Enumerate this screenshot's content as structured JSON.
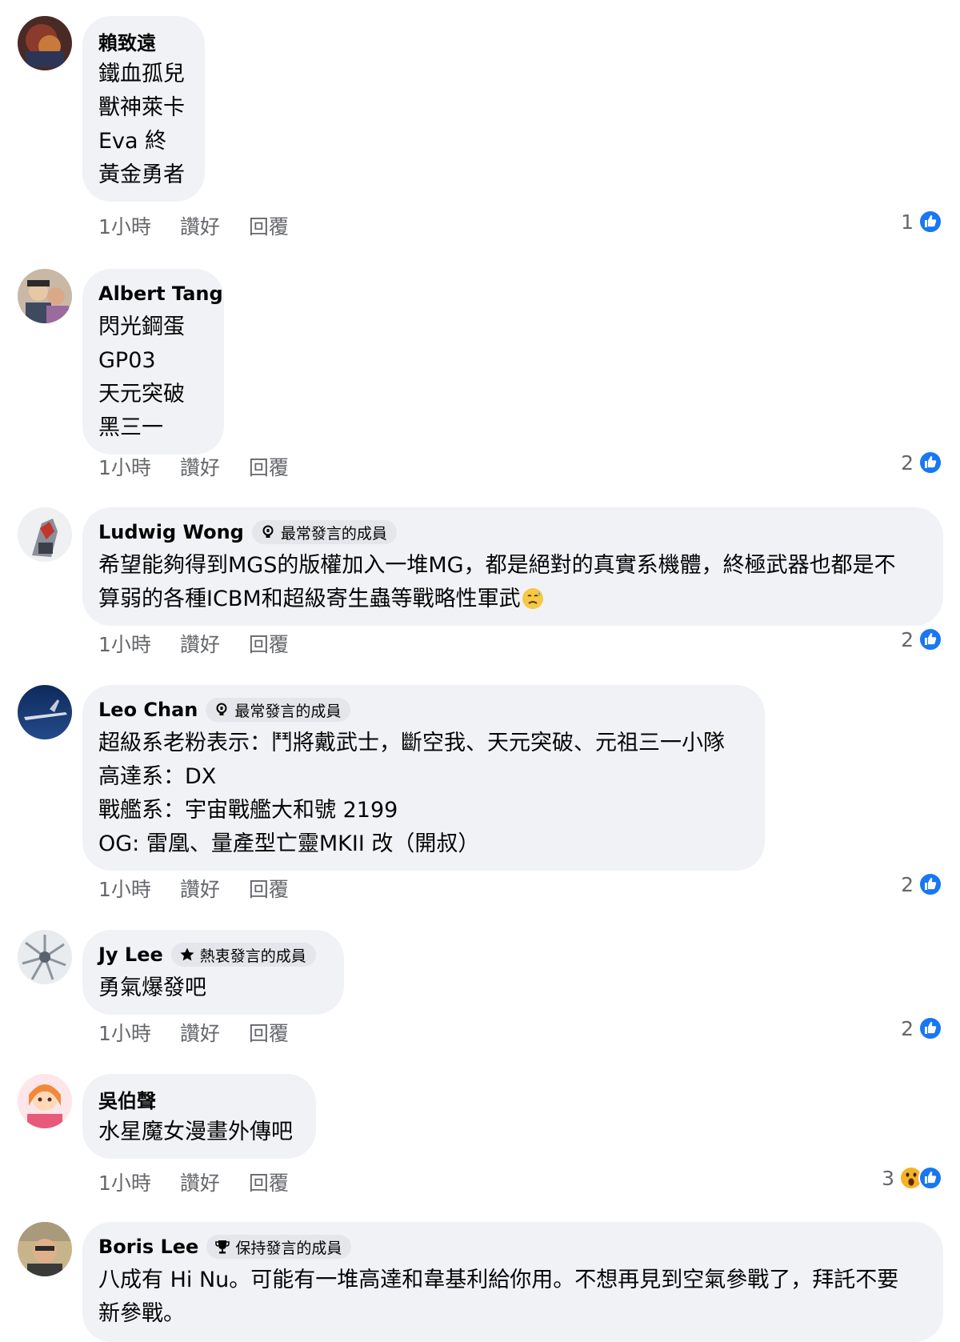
{
  "comments": [
    {
      "author": "賴致遠",
      "badge": "",
      "lines": [
        "鐵血孤兒",
        "獸神萊卡",
        "Eva 終",
        "黃金勇者"
      ],
      "time": "1小時",
      "like_label": "讚好",
      "reply_label": "回覆",
      "reaction_count": "1",
      "reactions": [
        "like"
      ]
    },
    {
      "author": "Albert Tang",
      "badge": "",
      "lines": [
        "閃光鋼蛋",
        "GP03",
        "天元突破",
        "黑三一"
      ],
      "time": "1小時",
      "like_label": "讚好",
      "reply_label": "回覆",
      "reaction_count": "2",
      "reactions": [
        "like"
      ]
    },
    {
      "author": "Ludwig Wong",
      "badge": "最常發言的成員",
      "badge_icon": "lightbulb-icon",
      "lines": [
        "希望能夠得到MGS的版權加入一堆MG，都是絕對的真實系機體，終極武器也都是不",
        "算弱的各種ICBM和超級寄生蟲等戰略性軍武"
      ],
      "inline_emoji": "sad-sweat-emoji",
      "time": "1小時",
      "like_label": "讚好",
      "reply_label": "回覆",
      "reaction_count": "2",
      "reactions": [
        "like"
      ]
    },
    {
      "author": "Leo Chan",
      "badge": "最常發言的成員",
      "badge_icon": "lightbulb-icon",
      "lines": [
        "超級系老粉表示：鬥將戴武士，斷空我、天元突破、元祖三一小隊",
        "高達系：DX",
        "戰艦系：宇宙戰艦大和號 2199",
        "OG: 雷凰、量產型亡靈MKII 改（開叔）"
      ],
      "time": "1小時",
      "like_label": "讚好",
      "reply_label": "回覆",
      "reaction_count": "2",
      "reactions": [
        "like"
      ]
    },
    {
      "author": "Jy Lee",
      "badge": "熱衷發言的成員",
      "badge_icon": "star-icon",
      "lines": [
        "勇氣爆發吧"
      ],
      "time": "1小時",
      "like_label": "讚好",
      "reply_label": "回覆",
      "reaction_count": "2",
      "reactions": [
        "like"
      ]
    },
    {
      "author": "吳伯聲",
      "badge": "",
      "lines": [
        "水星魔女漫畫外傳吧"
      ],
      "time": "1小時",
      "like_label": "讚好",
      "reply_label": "回覆",
      "reaction_count": "3",
      "reactions": [
        "wow",
        "like"
      ]
    },
    {
      "author": "Boris Lee",
      "badge": "保持發言的成員",
      "badge_icon": "trophy-icon",
      "lines": [
        "八成有 Hi Nu。可能有一堆高達和韋基利給你用。不想再見到空氣參戰了，拜託不要",
        "新參戰。"
      ],
      "time": "",
      "like_label": "",
      "reply_label": "",
      "reaction_count": "",
      "reactions": []
    }
  ],
  "colors": {
    "like_blue": "#1877f2",
    "bubble_bg": "#f0f2f5",
    "meta_gray": "#65676b"
  }
}
